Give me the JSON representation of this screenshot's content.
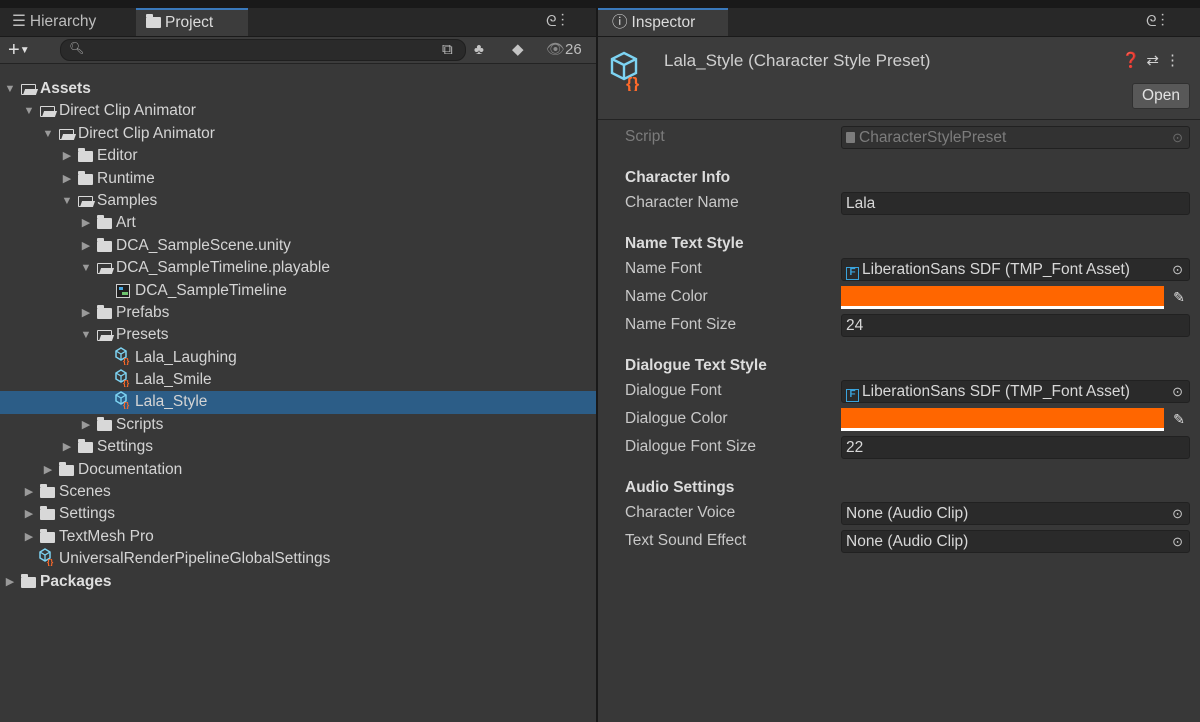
{
  "left_tabs": [
    {
      "label": "Hierarchy",
      "icon": "hierarchy-list-icon",
      "active": false
    },
    {
      "label": "Project",
      "icon": "folder-icon",
      "active": true
    }
  ],
  "project_toolbar": {
    "add_icon": "plus-icon",
    "search_placeholder": "",
    "hidden_count": "26"
  },
  "tree": [
    {
      "label": "Assets",
      "expanded": true,
      "type": "folder",
      "bold": true
    },
    {
      "label": "Direct Clip Animator",
      "expanded": true,
      "type": "folder"
    },
    {
      "label": "Direct Clip Animator",
      "expanded": true,
      "type": "folder"
    },
    {
      "label": "Editor",
      "expanded": false,
      "type": "folder"
    },
    {
      "label": "Runtime",
      "expanded": false,
      "type": "folder"
    },
    {
      "label": "Samples",
      "expanded": true,
      "type": "folder"
    },
    {
      "label": "Art",
      "expanded": false,
      "type": "folder"
    },
    {
      "label": "DCA_SampleScene.unity",
      "expanded": false,
      "type": "folder"
    },
    {
      "label": "DCA_SampleTimeline.playable",
      "expanded": true,
      "type": "folder"
    },
    {
      "label": "DCA_SampleTimeline",
      "type": "timeline"
    },
    {
      "label": "Prefabs",
      "expanded": false,
      "type": "folder"
    },
    {
      "label": "Presets",
      "expanded": true,
      "type": "folder"
    },
    {
      "label": "Lala_Laughing",
      "type": "preset"
    },
    {
      "label": "Lala_Smile",
      "type": "preset"
    },
    {
      "label": "Lala_Style",
      "type": "preset",
      "selected": true
    },
    {
      "label": "Scripts",
      "expanded": false,
      "type": "folder"
    },
    {
      "label": "Settings",
      "expanded": false,
      "type": "folder"
    },
    {
      "label": "Documentation",
      "expanded": false,
      "type": "folder"
    },
    {
      "label": "Scenes",
      "expanded": false,
      "type": "folder"
    },
    {
      "label": "Settings",
      "expanded": false,
      "type": "folder"
    },
    {
      "label": "TextMesh Pro",
      "expanded": false,
      "type": "folder"
    },
    {
      "label": "UniversalRenderPipelineGlobalSettings",
      "type": "preset"
    },
    {
      "label": "Packages",
      "expanded": false,
      "type": "folder",
      "bold": true
    }
  ],
  "inspector": {
    "tab_label": "Inspector",
    "title": "Lala_Style (Character Style Preset)",
    "open_label": "Open",
    "script_label": "Script",
    "script_value": "CharacterStylePreset",
    "sections": {
      "character_info": "Character Info",
      "name_text_style": "Name Text Style",
      "dialogue_text_style": "Dialogue Text Style",
      "audio_settings": "Audio Settings"
    },
    "fields": {
      "character_name_label": "Character Name",
      "character_name_value": "Lala",
      "name_font_label": "Name Font",
      "name_font_value": "LiberationSans SDF (TMP_Font Asset)",
      "name_color_label": "Name Color",
      "name_color_value": "#ff6600",
      "name_font_size_label": "Name Font Size",
      "name_font_size_value": "24",
      "dialogue_font_label": "Dialogue Font",
      "dialogue_font_value": "LiberationSans SDF (TMP_Font Asset)",
      "dialogue_color_label": "Dialogue Color",
      "dialogue_color_value": "#ff6600",
      "dialogue_font_size_label": "Dialogue Font Size",
      "dialogue_font_size_value": "22",
      "character_voice_label": "Character Voice",
      "character_voice_value": "None (Audio Clip)",
      "text_sound_effect_label": "Text Sound Effect",
      "text_sound_effect_value": "None (Audio Clip)"
    }
  },
  "colors": {
    "selection": "#2c5d87",
    "accent_tab": "#3a79bb",
    "preset_icon": "#7dd3f2",
    "tmp_icon": "#3aa3dc"
  }
}
